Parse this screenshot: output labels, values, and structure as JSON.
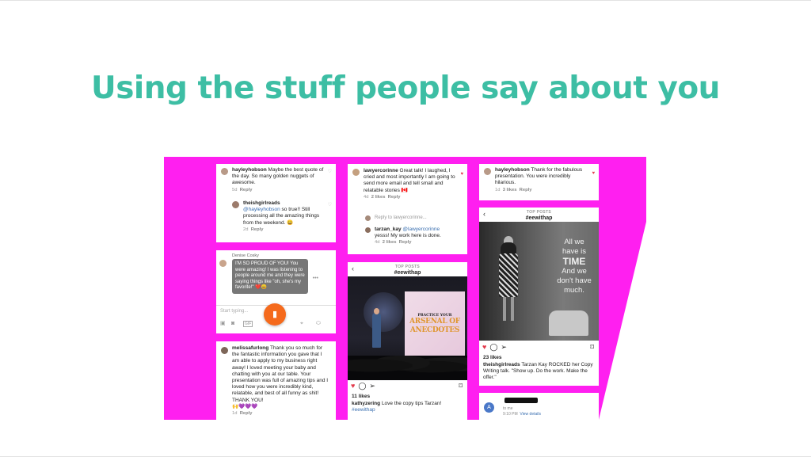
{
  "slide": {
    "title": "Using the stuff people say about you"
  },
  "comments": {
    "hayley": {
      "user": "hayleyhobson",
      "text": "Maybe the best quote of the day. So many golden nuggets of awesome.",
      "time": "5d",
      "reply": "Reply"
    },
    "theishgirl_reply": {
      "user": "theishgirlreads",
      "mention": "@hayleyhobson",
      "text": "so true!! Still processing all the amazing things from the weekend. 😀",
      "time": "2d",
      "reply": "Reply"
    },
    "lawyer": {
      "user": "lawyercorinne",
      "text": "Great talk! I laughed, I cried and most importantly I am going to send more email and tell small and relatable stories 🇨🇦",
      "time": "4d",
      "likes": "2 likes",
      "reply": "Reply"
    },
    "reply_to": "Reply to lawyercorinne...",
    "tarzan": {
      "user": "tarzan_kay",
      "mention": "@lawyercorinne",
      "text": "yesss! My work here is done.",
      "time": "4d",
      "likes": "2 likes",
      "reply": "Reply"
    },
    "hayley2": {
      "user": "hayleyhobson",
      "text": "Thank for the fabulous presentation. You were incredibly hilarious.",
      "time": "1d",
      "likes": "3 likes",
      "reply": "Reply"
    },
    "melissa": {
      "user": "melissafurlong",
      "text": "Thank you so much for the fantastic information you gave that I am able to apply to my business right away! I loved meeting your baby and chatting with you at our table. Your presentation was full of amazing tips and I loved how you were incredibly kind, relatable, and best of all funny as shit!  THANK YOU!",
      "emojis": "🙌💜💜💜",
      "time": "1d",
      "reply": "Reply"
    }
  },
  "message": {
    "sender": "Denise Cosky",
    "text": "I'M SO PROUD OF YOU! You were amazing! I was listening to people around me and they were saying things like \"oh, she's my favorite!\" ❤️😀",
    "placeholder": "Start typing..."
  },
  "post1": {
    "header_small": "TOP POSTS",
    "header": "#eewithap",
    "slide_line1": "PRACTICE YOUR",
    "slide_line2": "ARSENAL OF",
    "slide_line3": "ANECDOTES",
    "likes": "11 likes",
    "caption_user": "kathyzering",
    "caption": "Love the copy tips Tarzan!",
    "hashtag": "#eewithap"
  },
  "post2": {
    "header_small": "TOP POSTS",
    "header": "#eewithap",
    "overlay_lines": [
      "All we",
      "have is",
      "TIME",
      "And we",
      "don't have",
      "much."
    ],
    "likes": "23 likes",
    "caption_user": "theishgirlreads",
    "caption": "Tarzan Kay ROCKED her Copy Writing talk. \"Show up. Do the work. Make the offer.\""
  },
  "email": {
    "avatar_letter": "A",
    "to": "to me",
    "time": "9:10 PM",
    "link": "View details"
  },
  "icons": [
    "heart-icon",
    "comment-icon",
    "share-icon",
    "bookmark-icon",
    "back-icon",
    "image-icon",
    "camera-icon",
    "gif-icon",
    "location-icon",
    "pill-icon",
    "orange-fab-icon"
  ],
  "colors": {
    "title": "#3dbea4",
    "collage_bg": "#ff1ff0",
    "fab": "#f56a1c",
    "heart": "#e23b4c"
  }
}
